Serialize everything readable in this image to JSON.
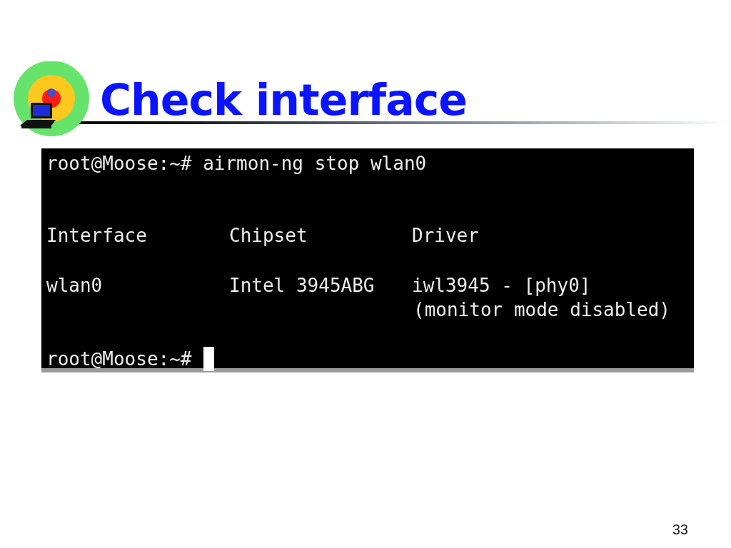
{
  "slide": {
    "title": "Check interface",
    "page_number": "33"
  },
  "terminal": {
    "command_line": "root@Moose:~# airmon-ng stop wlan0",
    "columns": [
      "Interface",
      "Chipset",
      "Driver"
    ],
    "rows": [
      {
        "cells": [
          "wlan0",
          "Intel 3945ABG",
          "iwl3945 - [phy0]"
        ],
        "note": "(monitor mode disabled)"
      }
    ],
    "final_prompt": "root@Moose:~#",
    "cursor": true
  }
}
